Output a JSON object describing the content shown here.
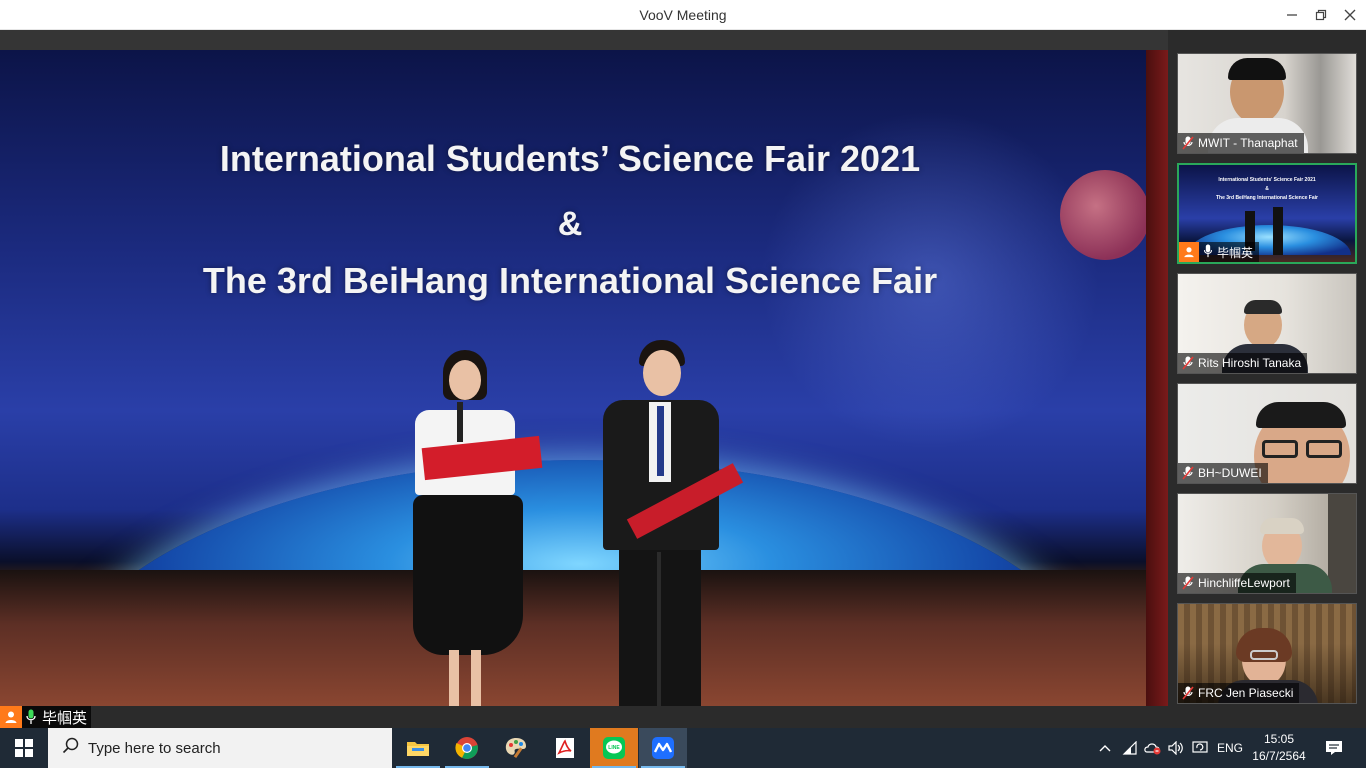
{
  "window": {
    "title": "VooV Meeting"
  },
  "main_video": {
    "stage_line1": "International Students’ Science Fair 2021",
    "stage_line2": "&",
    "stage_line3": "The 3rd BeiHang International Science Fair",
    "speaker_name": "毕帼英"
  },
  "participants": [
    {
      "name": "MWIT - Thanaphat",
      "muted": true,
      "active": false,
      "bg": "#d9d6d2"
    },
    {
      "name": "毕帼英",
      "muted": false,
      "active": true,
      "bg": "#1c2c86"
    },
    {
      "name": "Rits Hiroshi Tanaka",
      "muted": true,
      "active": false,
      "bg": "#e8e6e2"
    },
    {
      "name": "BH~DUWEI",
      "muted": true,
      "active": false,
      "bg": "#e2e2df"
    },
    {
      "name": "HinchliffeLewport",
      "muted": true,
      "active": false,
      "bg": "#cfc9c0"
    },
    {
      "name": "FRC Jen Piasecki",
      "muted": true,
      "active": false,
      "bg": "#5a4632"
    }
  ],
  "mini_stage": {
    "line1": "International Students' Science Fair 2021",
    "line2": "&",
    "line3": "The 3rd BeiHang International Science Fair"
  },
  "taskbar": {
    "search_placeholder": "Type here to search",
    "language": "ENG",
    "time": "15:05",
    "date": "16/7/2564"
  },
  "colors": {
    "accent_active": "#2aa85a",
    "avatar": "#ff7a1a",
    "taskbar": "#1f2a36"
  }
}
